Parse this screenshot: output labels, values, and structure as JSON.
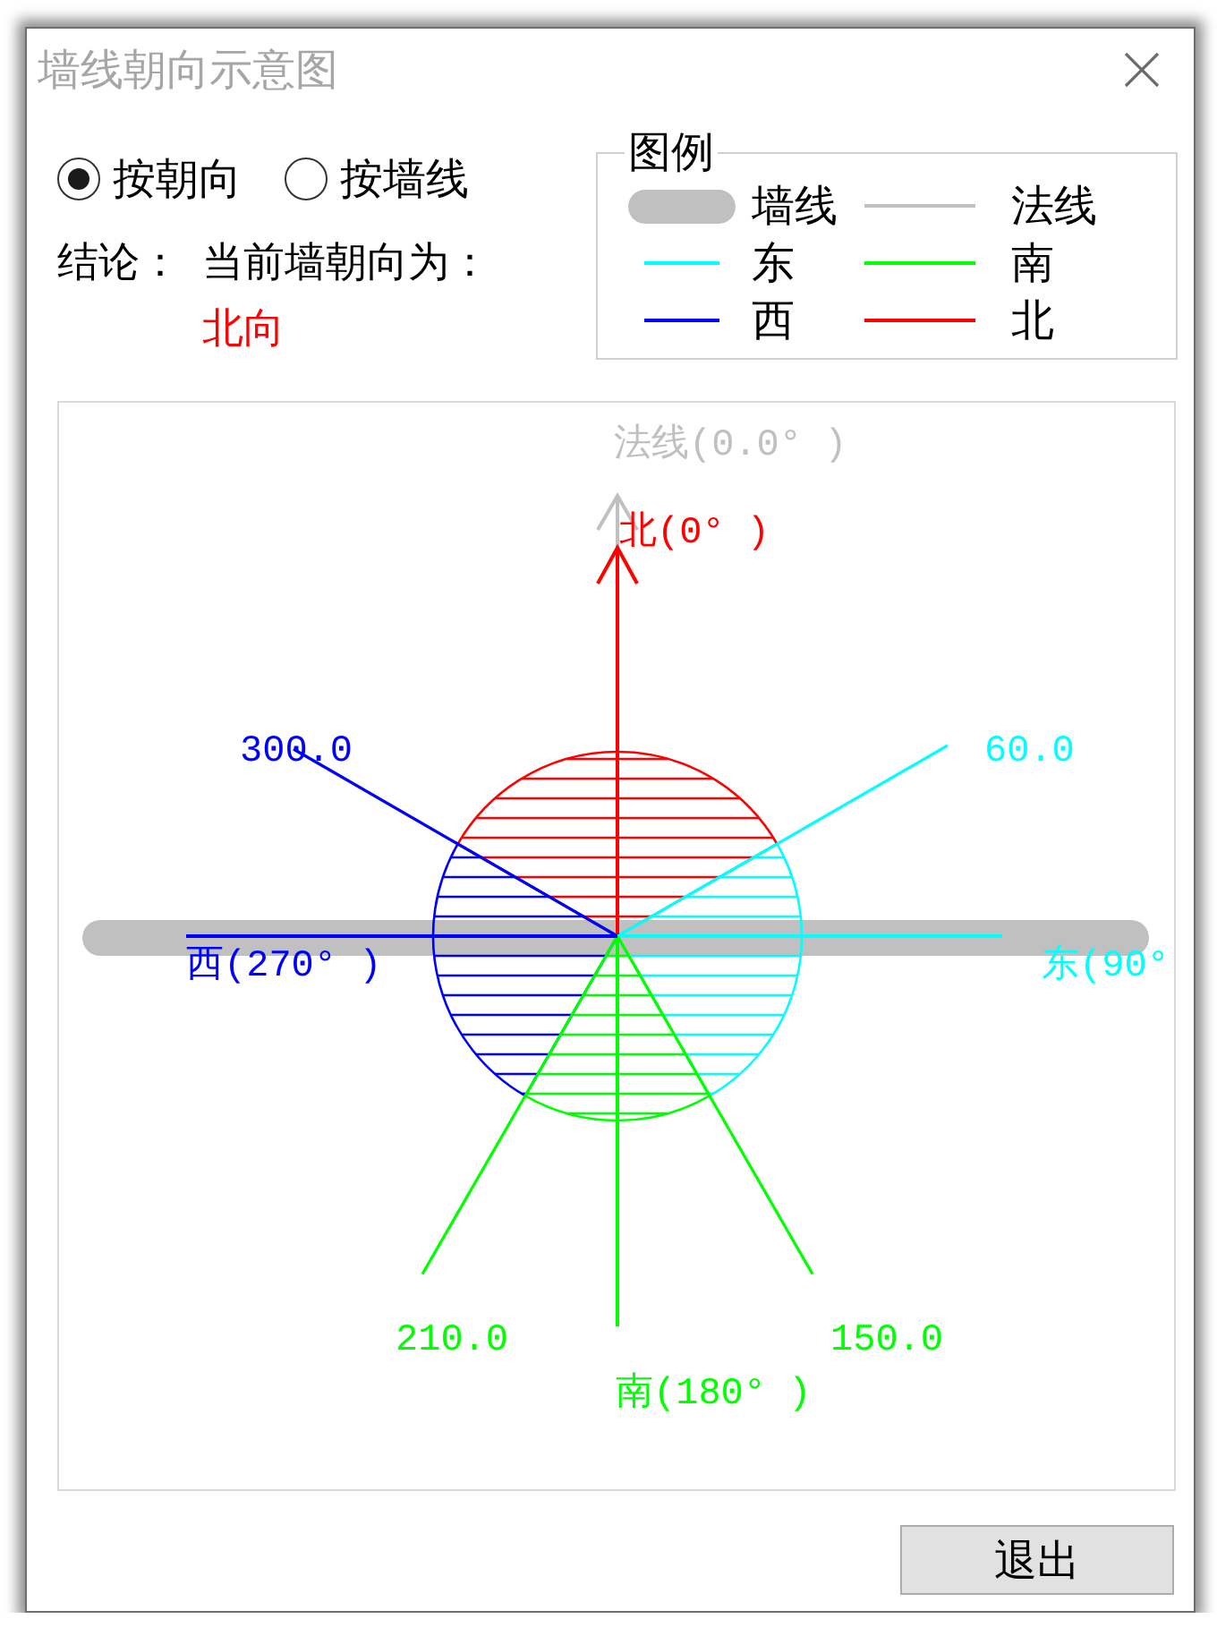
{
  "window": {
    "title": "墙线朝向示意图"
  },
  "mode_options": [
    {
      "label": "按朝向",
      "selected": true
    },
    {
      "label": "按墙线",
      "selected": false
    }
  ],
  "conclusion": {
    "label": "结论：",
    "text": "当前墙朝向为：",
    "value": "北向"
  },
  "legend": {
    "title": "图例",
    "items": [
      {
        "kind": "wall",
        "label": "墙线",
        "color": "#c0c0c0"
      },
      {
        "kind": "line",
        "label": "法线",
        "color": "#c0c0c0"
      },
      {
        "kind": "line",
        "label": "东",
        "color": "#00ffff"
      },
      {
        "kind": "line",
        "label": "南",
        "color": "#00ff00"
      },
      {
        "kind": "line",
        "label": "西",
        "color": "#0000ff"
      },
      {
        "kind": "line",
        "label": "北",
        "color": "#ff0000"
      }
    ]
  },
  "diagram": {
    "normal_label": "法线(0.0° )",
    "directions": [
      {
        "label": "北(0° )",
        "color": "#ff0000"
      },
      {
        "label": "东(90°",
        "color": "#00ffff"
      },
      {
        "label": "南(180° )",
        "color": "#00ff00"
      },
      {
        "label": "西(270° )",
        "color": "#0000ff"
      }
    ],
    "boundaries": [
      {
        "label": "300.0",
        "color": "#0000ff"
      },
      {
        "label": "60.0",
        "color": "#00ffff"
      },
      {
        "label": "210.0",
        "color": "#00ff00"
      },
      {
        "label": "150.0",
        "color": "#00ff00"
      }
    ]
  },
  "buttons": [
    {
      "label": "退出"
    }
  ]
}
